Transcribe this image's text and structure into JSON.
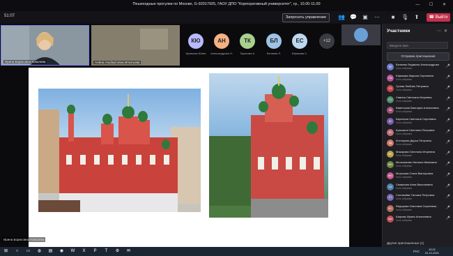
{
  "titlebar": {
    "title": "Пешеходные прогулки по Москве, G-92017925, ГАОУ ДПО \"Корпоративный университет\", гр., 10.00-11.00",
    "winctl": "— ☐ ✕"
  },
  "meeting": {
    "timer": "51:07",
    "request_control": "Запросить управление",
    "leave": "Выйти"
  },
  "tiles": [
    {
      "caption": "Ирина Борисовна Ковалева"
    },
    {
      "caption": "Алёна Альбертовна Игнатьева"
    }
  ],
  "avatars": [
    {
      "initials": "КЮ",
      "name": "Куликова Юлия",
      "color": "#b9b9ff"
    },
    {
      "initials": "АН",
      "name": "Александрова Н.",
      "color": "#f4b183"
    },
    {
      "initials": "ТК",
      "name": "Тарасова К.",
      "color": "#a9d18e"
    },
    {
      "initials": "БЛ",
      "name": "Беляева Л.",
      "color": "#9dc3e6"
    },
    {
      "initials": "ЕС",
      "name": "Ефимова С.",
      "color": "#bdd7ee"
    }
  ],
  "more_participants": "+12",
  "presenter_caption": "Ирина Борисовна Ковалева",
  "panel": {
    "title": "Участники",
    "search_placeholder": "Введите имя",
    "invite": "Отправка приглашения",
    "participants": [
      {
        "initials": "БЛ",
        "name": "Беляева Людмила Александровна",
        "note": "Гость собрания",
        "color": "#6f7ad0"
      },
      {
        "initials": "ЕМ",
        "name": "Ефимова Марина Сергеевна",
        "note": "Гость собрания",
        "color": "#b5549b"
      },
      {
        "initials": "ГЛ",
        "name": "Гусева Любовь Петровна",
        "note": "Гость собрания",
        "color": "#c44a4a"
      },
      {
        "initials": "СС",
        "name": "Савина Светлана Игоревна",
        "note": "Гость собрания",
        "color": "#4f8f6b"
      },
      {
        "initials": "КВ",
        "name": "Каменская Виктория Алексеевна",
        "note": "Гость собрания",
        "color": "#a34f7d"
      },
      {
        "initials": "КС",
        "name": "Карелина Светлана Сергеевна",
        "note": "Гость собрания",
        "color": "#7a5fb3"
      },
      {
        "initials": "КС",
        "name": "Кузьмина Светлана Петровна",
        "note": "Гость собрания",
        "color": "#c0707a"
      },
      {
        "initials": "КД",
        "name": "Котлярова Дарья Петровна",
        "note": "Гость собрания",
        "color": "#d2786c"
      },
      {
        "initials": "МС",
        "name": "Макарова Светлана Игоревна",
        "note": "Гость собрания",
        "color": "#b8a24a"
      },
      {
        "initials": "МН",
        "name": "Мельникова Наталья Ивановна",
        "note": "Гость собрания",
        "color": "#6d8f3f"
      },
      {
        "initials": "МО",
        "name": "Морозова Ольга Викторовна",
        "note": "Гость собрания",
        "color": "#c45b8c"
      },
      {
        "initials": "СА",
        "name": "Смирнова Анна Васильевна",
        "note": "Гость собрания",
        "color": "#4f7fb0"
      },
      {
        "initials": "СТ",
        "name": "Соловьёва Татьяна Петровна",
        "note": "Гость собрания",
        "color": "#7b6bb8"
      },
      {
        "initials": "ФС",
        "name": "Федорова Светлана Сергеевна",
        "note": "Гость собрания",
        "color": "#b66a5a"
      },
      {
        "initials": "ШИ",
        "name": "Шарова Ирина Алексеевна",
        "note": "Гость собрания",
        "color": "#c0505a"
      }
    ],
    "others": "Другие приглашенные (1)"
  },
  "taskbar": {
    "lang": "РУС",
    "time": "10:21",
    "date": "01.12.2021"
  }
}
